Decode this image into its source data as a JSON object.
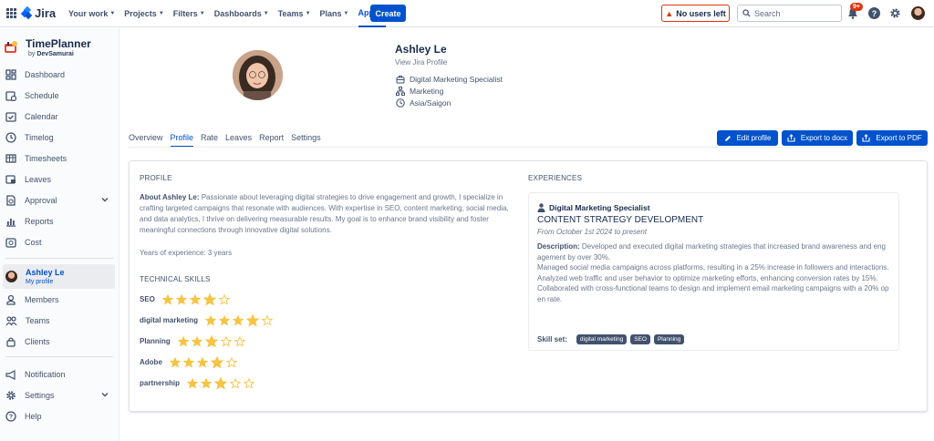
{
  "topnav": {
    "logo": "Jira",
    "menu": [
      {
        "label": "Your work"
      },
      {
        "label": "Projects"
      },
      {
        "label": "Filters"
      },
      {
        "label": "Dashboards"
      },
      {
        "label": "Teams"
      },
      {
        "label": "Plans"
      },
      {
        "label": "Apps",
        "active": true
      }
    ],
    "create_label": "Create",
    "no_users_label": "No users left",
    "search_placeholder": "Search",
    "notifications_badge": "9+",
    "help_label": "?"
  },
  "sidebar": {
    "app_title": "TimePlanner",
    "app_by_prefix": "by",
    "app_by_brand": "DevSamurai",
    "items": [
      {
        "label": "Dashboard",
        "icon": "dashboard-icon"
      },
      {
        "label": "Schedule",
        "icon": "schedule-icon"
      },
      {
        "label": "Calendar",
        "icon": "calendar-icon"
      },
      {
        "label": "Timelog",
        "icon": "clock-icon"
      },
      {
        "label": "Timesheets",
        "icon": "table-icon"
      },
      {
        "label": "Leaves",
        "icon": "leaves-icon"
      },
      {
        "label": "Approval",
        "icon": "approval-icon"
      },
      {
        "label": "Reports",
        "icon": "chart-icon"
      },
      {
        "label": "Cost",
        "icon": "cost-icon"
      }
    ],
    "user": {
      "name": "Ashley Le",
      "sub": "My profile"
    },
    "items2": [
      {
        "label": "Members",
        "icon": "member-icon"
      },
      {
        "label": "Teams",
        "icon": "teams-icon"
      },
      {
        "label": "Clients",
        "icon": "lock-icon"
      }
    ],
    "items3": [
      {
        "label": "Notification",
        "icon": "megaphone-icon"
      },
      {
        "label": "Settings",
        "icon": "gear-icon"
      },
      {
        "label": "Help",
        "icon": "help-icon"
      }
    ]
  },
  "profile": {
    "name": "Ashley Le",
    "view_link": "View Jira Profile",
    "job_title": "Digital Marketing Specialist",
    "department": "Marketing",
    "timezone": "Asia/Saigon"
  },
  "tabs": [
    "Overview",
    "Profile",
    "Rate",
    "Leaves",
    "Report",
    "Settings"
  ],
  "active_tab": "Profile",
  "actions": {
    "edit": "Edit profile",
    "docx": "Export to docx",
    "pdf": "Export to PDF"
  },
  "profile_section": {
    "title": "PROFILE",
    "about_label": "About Ashley Le:",
    "about_text": "Passionate about leveraging digital strategies to drive engagement and growth, I specialize in crafting targeted campaigns that resonate with audiences. With expertise in SEO, content marketing, social media, and data analytics, I thrive on delivering measurable results. My goal is to enhance brand visibility and foster meaningful connections through innovative digital solutions.",
    "years": "Years of experience: 3 years",
    "skills_title": "TECHNICAL SKILLS",
    "skills": [
      {
        "name": "SEO",
        "rating": 4,
        "max": 5
      },
      {
        "name": "digital marketing",
        "rating": 4,
        "max": 5
      },
      {
        "name": "Planning",
        "rating": 3,
        "max": 5
      },
      {
        "name": "Adobe",
        "rating": 4,
        "max": 5
      },
      {
        "name": "partnership",
        "rating": 3,
        "max": 5
      }
    ]
  },
  "experiences": {
    "title": "EXPERIENCES",
    "role": "Digital Marketing Specialist",
    "company": "CONTENT STRATEGY DEVELOPMENT",
    "date": "From October 1st 2024 to present",
    "desc_label": "Description:",
    "desc_lines": [
      "Developed and executed digital marketing strategies that increased brand awareness and engagement by over 30%.",
      "Managed social media campaigns across platforms, resulting in a 25% increase in followers and interactions.",
      "Analyzed web traffic and user behavior to optimize marketing efforts, enhancing conversion rates by 15%.",
      "Collaborated with cross-functional teams to design and implement email marketing campaigns with a 20% open rate."
    ],
    "skillset_label": "Skill set:",
    "tags": [
      "digital marketing",
      "SEO",
      "Planning"
    ]
  },
  "colors": {
    "accent": "#0052cc",
    "star": "#f6c343",
    "warning": "#de350b"
  }
}
